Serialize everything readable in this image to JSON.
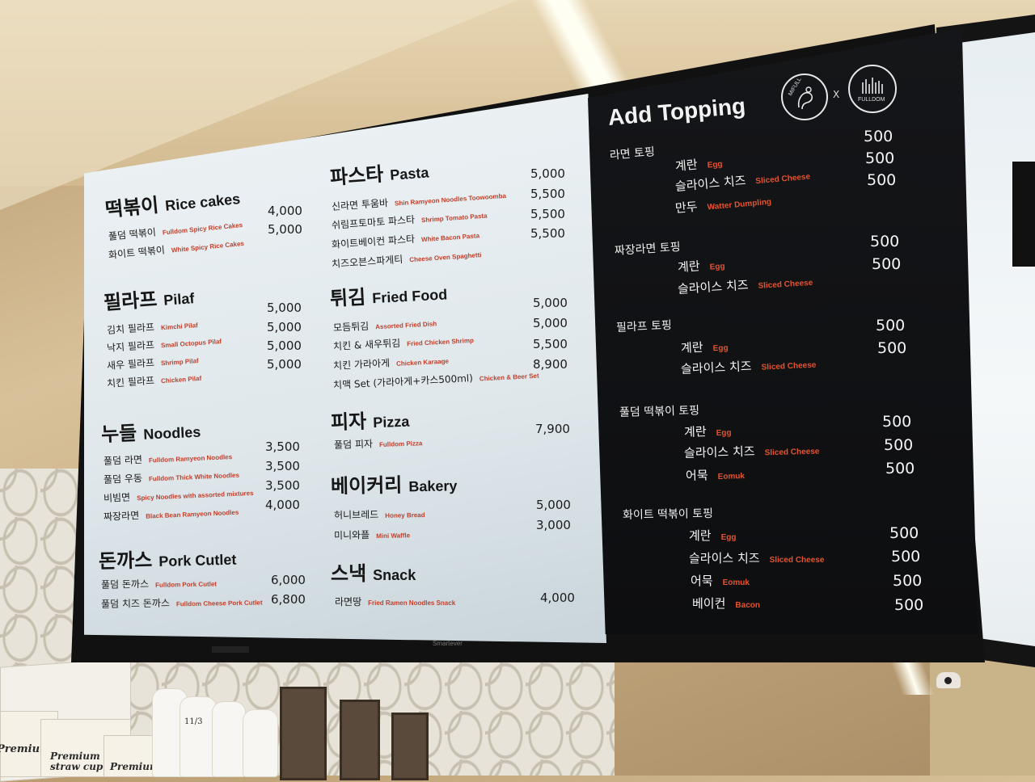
{
  "menu_left": {
    "sections": [
      {
        "ko": "떡볶이",
        "en": "Rice cakes",
        "items": [
          {
            "ko": "풀덤 떡볶이",
            "en": "Fulldom Spicy Rice Cakes",
            "price": "4,000"
          },
          {
            "ko": "화이트 떡볶이",
            "en": "White Spicy Rice Cakes",
            "price": "5,000"
          }
        ]
      },
      {
        "ko": "필라프",
        "en": "Pilaf",
        "items": [
          {
            "ko": "김치 필라프",
            "en": "Kimchi Pilaf",
            "price": "5,000"
          },
          {
            "ko": "낙지 필라프",
            "en": "Small Octopus Pilaf",
            "price": "5,000"
          },
          {
            "ko": "새우 필라프",
            "en": "Shrimp Pilaf",
            "price": "5,000"
          },
          {
            "ko": "치킨 필라프",
            "en": "Chicken Pilaf",
            "price": "5,000"
          }
        ]
      },
      {
        "ko": "누들",
        "en": "Noodles",
        "items": [
          {
            "ko": "풀덤 라면",
            "en": "Fulldom Ramyeon Noodles",
            "price": "3,500"
          },
          {
            "ko": "풀덤 우동",
            "en": "Fulldom Thick White Noodles",
            "price": "3,500"
          },
          {
            "ko": "비빔면",
            "en": "Spicy Noodles with assorted mixtures",
            "price": "3,500"
          },
          {
            "ko": "짜장라면",
            "en": "Black Bean Ramyeon Noodles",
            "price": "4,000"
          }
        ]
      },
      {
        "ko": "돈까스",
        "en": "Pork Cutlet",
        "items": [
          {
            "ko": "풀덤 돈까스",
            "en": "Fulldom Pork Cutlet",
            "price": "6,000"
          },
          {
            "ko": "풀덤 치즈 돈까스",
            "en": "Fulldom Cheese Pork Cutlet",
            "price": "6,800"
          }
        ]
      }
    ]
  },
  "menu_middle": {
    "sections": [
      {
        "ko": "파스타",
        "en": "Pasta",
        "items": [
          {
            "ko": "신라면 투움바",
            "en": "Shin Ramyeon Noodles Toowoomba",
            "price": "5,000"
          },
          {
            "ko": "쉬림프토마토 파스타",
            "en": "Shrimp Tomato Pasta",
            "price": "5,500"
          },
          {
            "ko": "화이트베이컨 파스타",
            "en": "White Bacon Pasta",
            "price": "5,500"
          },
          {
            "ko": "치즈오븐스파게티",
            "en": "Cheese Oven Spaghetti",
            "price": "5,500"
          }
        ]
      },
      {
        "ko": "튀김",
        "en": "Fried Food",
        "items": [
          {
            "ko": "모듬튀김",
            "en": "Assorted Fried Dish",
            "price": "5,000"
          },
          {
            "ko": "치킨 & 새우튀김",
            "en": "Fried Chicken Shrimp",
            "price": "5,000"
          },
          {
            "ko": "치킨 가라아게",
            "en": "Chicken Karaage",
            "price": "5,500"
          },
          {
            "ko": "치맥 Set (가라아게+카스500ml)",
            "en": "Chicken & Beer Set",
            "price": "8,900"
          }
        ]
      },
      {
        "ko": "피자",
        "en": "Pizza",
        "items": [
          {
            "ko": "풀덤 피자",
            "en": "Fulldom Pizza",
            "price": "7,900"
          }
        ]
      },
      {
        "ko": "베이커리",
        "en": "Bakery",
        "items": [
          {
            "ko": "허니브레드",
            "en": "Honey Bread",
            "price": "5,000"
          },
          {
            "ko": "미니와플",
            "en": "Mini Waffle",
            "price": "3,000"
          }
        ]
      },
      {
        "ko": "스낵",
        "en": "Snack",
        "items": [
          {
            "ko": "라면땅",
            "en": "Fried Ramen Noodles Snack",
            "price": "4,000"
          }
        ]
      }
    ]
  },
  "topping": {
    "title": "Add Topping",
    "logo_left": "MIFULL",
    "logo_x": "X",
    "logo_right": "FULLDOM",
    "groups": [
      {
        "name": "라면 토핑",
        "items": [
          {
            "ko": "계란",
            "en": "Egg",
            "price": "500"
          },
          {
            "ko": "슬라이스 치즈",
            "en": "Sliced Cheese",
            "price": "500"
          },
          {
            "ko": "만두",
            "en": "Watter Dumpling",
            "price": "500"
          }
        ]
      },
      {
        "name": "짜장라면 토핑",
        "items": [
          {
            "ko": "계란",
            "en": "Egg",
            "price": "500"
          },
          {
            "ko": "슬라이스 치즈",
            "en": "Sliced Cheese",
            "price": "500"
          }
        ]
      },
      {
        "name": "필라프 토핑",
        "items": [
          {
            "ko": "계란",
            "en": "Egg",
            "price": "500"
          },
          {
            "ko": "슬라이스 치즈",
            "en": "Sliced Cheese",
            "price": "500"
          }
        ]
      },
      {
        "name": "풀덤 떡볶이 토핑",
        "items": [
          {
            "ko": "계란",
            "en": "Egg",
            "price": "500"
          },
          {
            "ko": "슬라이스 치즈",
            "en": "Sliced Cheese",
            "price": "500"
          },
          {
            "ko": "어묵",
            "en": "Eomuk",
            "price": "500"
          }
        ]
      },
      {
        "name": "화이트 떡볶이 토핑",
        "items": [
          {
            "ko": "계란",
            "en": "Egg",
            "price": "500"
          },
          {
            "ko": "슬라이스 치즈",
            "en": "Sliced Cheese",
            "price": "500"
          },
          {
            "ko": "어묵",
            "en": "Eomuk",
            "price": "500"
          },
          {
            "ko": "베이컨",
            "en": "Bacon",
            "price": "500"
          }
        ]
      }
    ]
  },
  "tv_brand": "Smartever",
  "shelf": {
    "box_label": "Premium",
    "box_label_2": "Premium straw cup",
    "bottle_label": "11/3"
  }
}
